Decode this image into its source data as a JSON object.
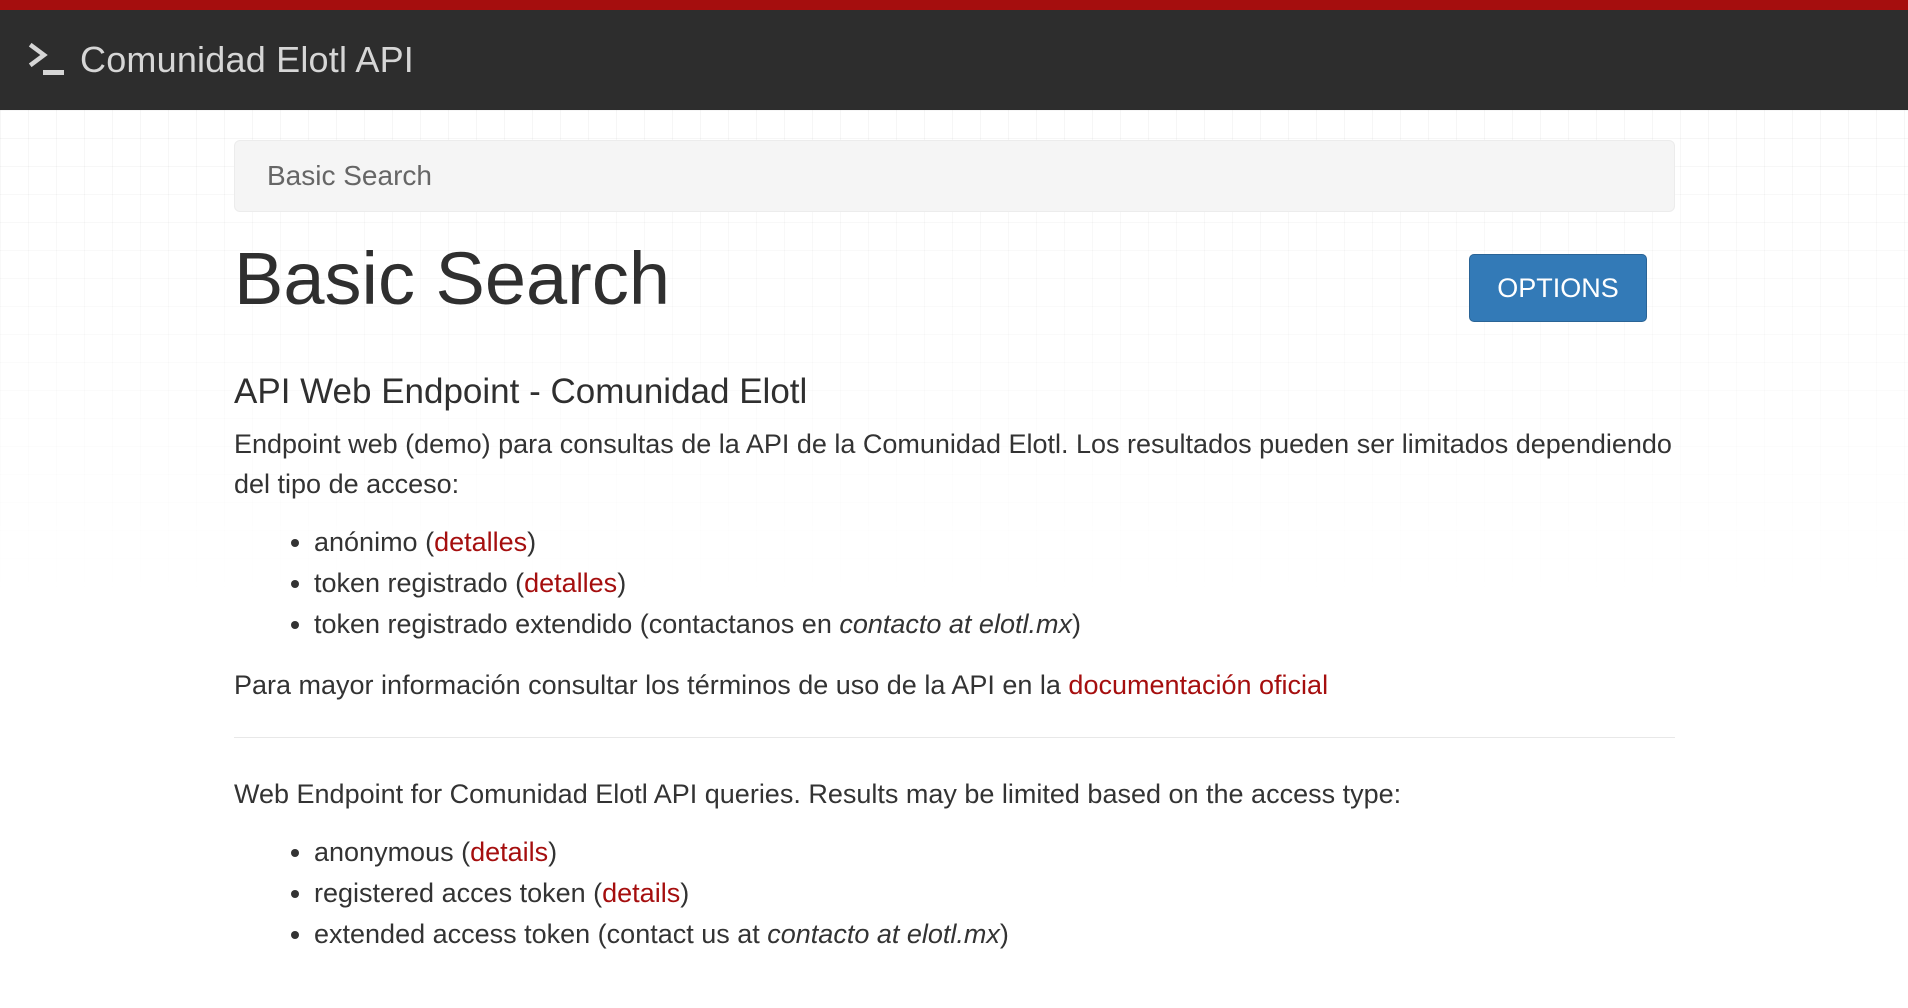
{
  "navbar": {
    "brand_text": "Comunidad Elotl API",
    "brand_icon": "terminal-prompt-icon",
    "accent_color": "#a50e0e",
    "background_color": "#2d2d2d"
  },
  "search": {
    "placeholder": "Basic Search"
  },
  "header": {
    "title": "Basic Search",
    "options_label": "OPTIONS",
    "options_color": "#337ab7"
  },
  "spanish": {
    "heading": "API Web Endpoint - Comunidad Elotl",
    "intro": "Endpoint web (demo) para consultas de la API de la Comunidad Elotl. Los resultados pueden ser limitados dependiendo del tipo de acceso:",
    "items": [
      {
        "prefix": "anónimo (",
        "link": "detalles",
        "suffix": ")"
      },
      {
        "prefix": "token registrado (",
        "link": "detalles",
        "suffix": ")"
      },
      {
        "prefix": "token registrado extendido (contactanos en ",
        "emphasis": "contacto at elotl.mx",
        "suffix": ")"
      }
    ],
    "more_info_prefix": "Para mayor información consultar los términos de uso de la API en la ",
    "more_info_link": "documentación oficial"
  },
  "english": {
    "intro": "Web Endpoint for Comunidad Elotl API queries. Results may be limited based on the access type:",
    "items": [
      {
        "prefix": "anonymous (",
        "link": "details",
        "suffix": ")"
      },
      {
        "prefix": "registered acces token (",
        "link": "details",
        "suffix": ")"
      },
      {
        "prefix": "extended access token (contact us at ",
        "emphasis": "contacto at elotl.mx",
        "suffix": ")"
      }
    ]
  },
  "link_color": "#a50e0e"
}
